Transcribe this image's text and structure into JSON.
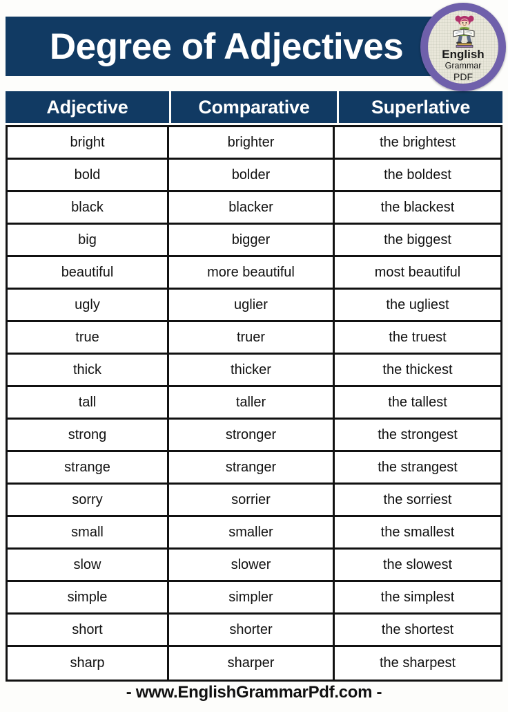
{
  "page": {
    "title": "Degree of Adjectives",
    "background_color": "#fdfdfb",
    "accent_color": "#113a63",
    "border_color": "#111111"
  },
  "badge": {
    "line1": "English",
    "line2": "Grammar",
    "line3": "PDF",
    "ring_color": "#6f60ab",
    "face_color": "#e9e7da",
    "icon": "student-reading-book-icon"
  },
  "table": {
    "columns": [
      "Adjective",
      "Comparative",
      "Superlative"
    ],
    "rows": [
      [
        "bright",
        "brighter",
        "the brightest"
      ],
      [
        "bold",
        "bolder",
        "the boldest"
      ],
      [
        "black",
        "blacker",
        "the blackest"
      ],
      [
        "big",
        "bigger",
        "the biggest"
      ],
      [
        "beautiful",
        "more beautiful",
        "most beautiful"
      ],
      [
        "ugly",
        "uglier",
        "the ugliest"
      ],
      [
        "true",
        "truer",
        "the truest"
      ],
      [
        "thick",
        "thicker",
        "the thickest"
      ],
      [
        "tall",
        "taller",
        "the tallest"
      ],
      [
        "strong",
        "stronger",
        "the strongest"
      ],
      [
        "strange",
        "stranger",
        "the strangest"
      ],
      [
        "sorry",
        "sorrier",
        "the sorriest"
      ],
      [
        "small",
        "smaller",
        "the smallest"
      ],
      [
        "slow",
        "slower",
        "the slowest"
      ],
      [
        "simple",
        "simpler",
        "the simplest"
      ],
      [
        "short",
        "shorter",
        "the shortest"
      ],
      [
        "sharp",
        "sharper",
        "the sharpest"
      ]
    ]
  },
  "footer": {
    "text": "- www.EnglishGrammarPdf.com -"
  }
}
